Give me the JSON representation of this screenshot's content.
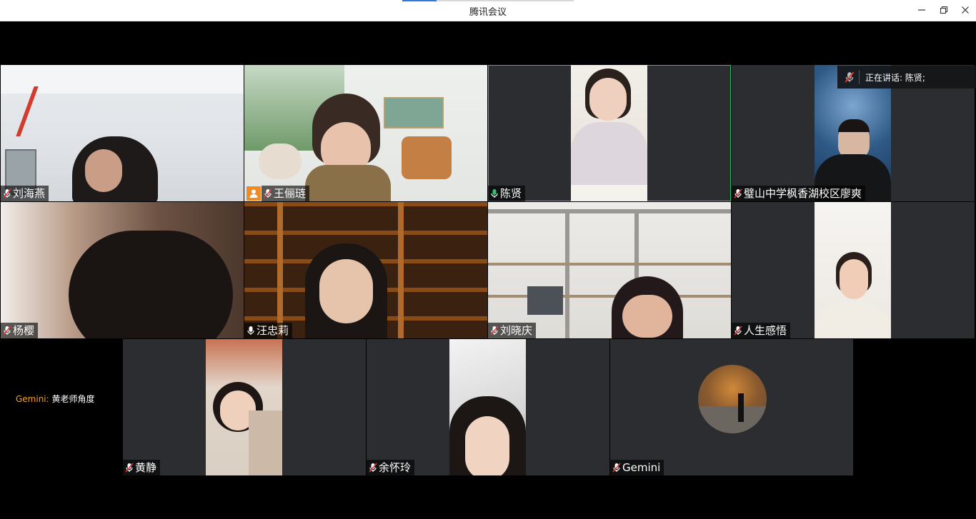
{
  "window": {
    "title": "腾讯会议",
    "controls": [
      "minimize-icon",
      "restore-icon",
      "close-icon"
    ]
  },
  "speaking_indicator": {
    "text": "正在讲话: 陈贤;"
  },
  "caption": {
    "speaker": "Gemini:",
    "text": "黄老师角度"
  },
  "participants": [
    {
      "name": "刘海燕",
      "mic": "muted"
    },
    {
      "name": "王俪琏",
      "mic": "muted",
      "host": true
    },
    {
      "name": "陈贤",
      "mic": "active",
      "speaking": true
    },
    {
      "name": "璧山中学枫香湖校区廖爽",
      "mic": "muted"
    },
    {
      "name": "杨樱",
      "mic": "muted"
    },
    {
      "name": "汪忠莉",
      "mic": "on"
    },
    {
      "name": "刘晓庆",
      "mic": "muted"
    },
    {
      "name": "人生感悟",
      "mic": "muted"
    },
    {
      "name": "黄静",
      "mic": "muted"
    },
    {
      "name": "余怀玲",
      "mic": "muted"
    },
    {
      "name": "Gemini",
      "mic": "muted",
      "video": false
    }
  ],
  "colors": {
    "tile_bg": "#2b2d30",
    "active_border": "#2ec26b",
    "mic_active": "#2ec26b",
    "mic_muted_slash": "#e53935",
    "host_badge": "#f08a24",
    "caption_speaker": "#f0a033"
  }
}
